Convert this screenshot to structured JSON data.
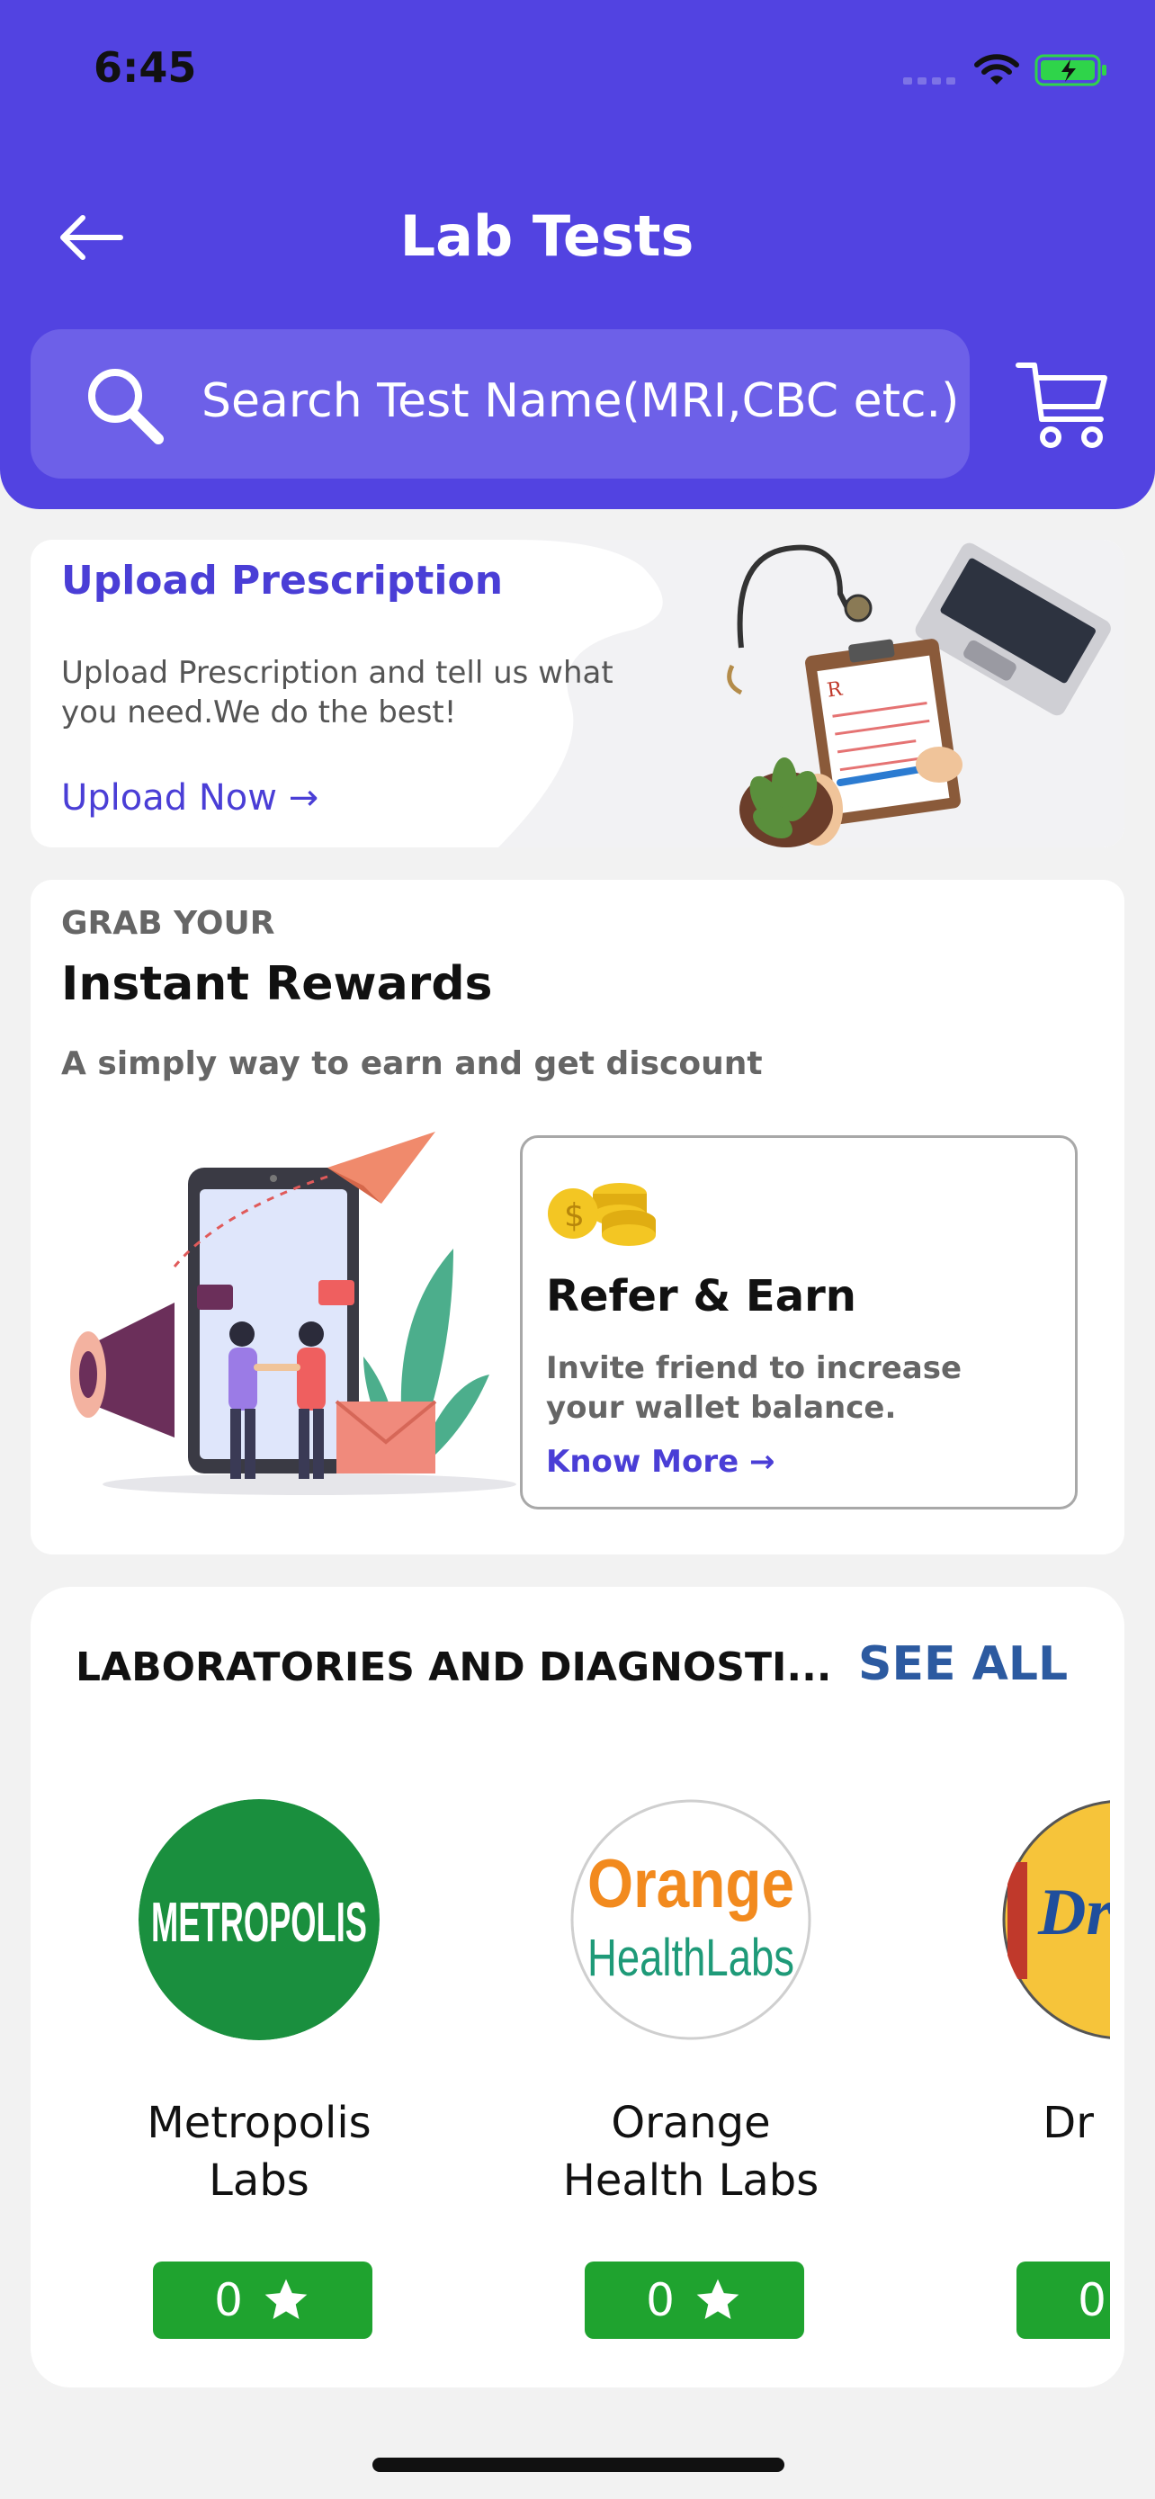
{
  "status_bar": {
    "time": "6:45"
  },
  "header": {
    "title": "Lab Tests",
    "search_placeholder": "Search Test Name(MRI,CBC etc.)"
  },
  "upload": {
    "title": "Upload Prescription",
    "description": "Upload Prescription and tell us what you need.We do the best!",
    "link": "Upload Now →"
  },
  "rewards": {
    "kicker": "GRAB YOUR",
    "title": "Instant Rewards",
    "subtitle": "A simply way to earn and get discount",
    "refer": {
      "title": "Refer & Earn",
      "description": "Invite friend to increase your wallet balance.",
      "link": "Know More →"
    }
  },
  "labs": {
    "heading": "LABORATORIES AND DIAGNOSTI...",
    "see_all": "SEE ALL",
    "items": [
      {
        "name": "Metropolis Labs",
        "rating": "0",
        "logo_text": "METROPOLIS"
      },
      {
        "name": "Orange Health Labs",
        "rating": "0",
        "logo_text_1": "Orange",
        "logo_text_2": "HealthLabs"
      },
      {
        "name": "Dr Path",
        "rating": "0",
        "logo_text": "DrLa"
      }
    ]
  },
  "colors": {
    "primary": "#5243e1",
    "accent_text": "#4a3ed6",
    "rating_green": "#1fa32f",
    "see_all": "#2c5aa0"
  }
}
